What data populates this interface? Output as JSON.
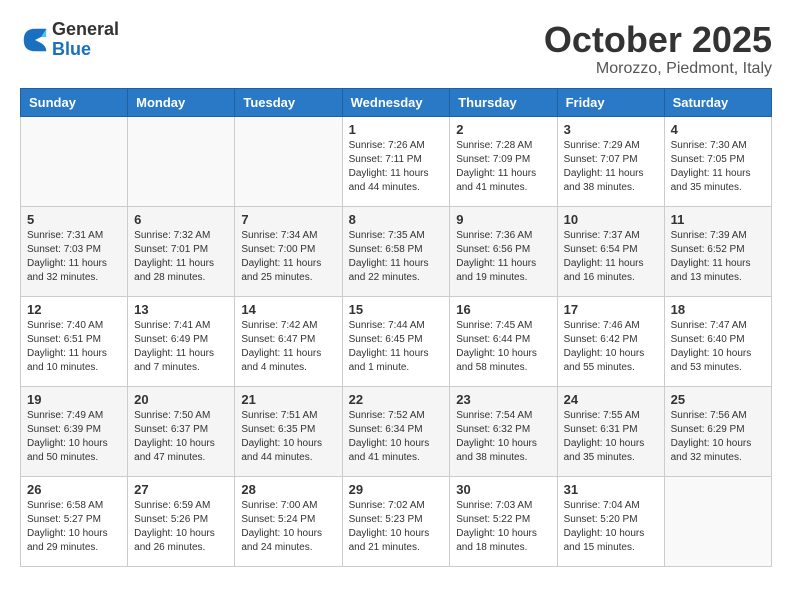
{
  "logo": {
    "line1": "General",
    "line2": "Blue"
  },
  "title": "October 2025",
  "location": "Morozzo, Piedmont, Italy",
  "weekdays": [
    "Sunday",
    "Monday",
    "Tuesday",
    "Wednesday",
    "Thursday",
    "Friday",
    "Saturday"
  ],
  "weeks": [
    [
      {
        "day": "",
        "info": ""
      },
      {
        "day": "",
        "info": ""
      },
      {
        "day": "",
        "info": ""
      },
      {
        "day": "1",
        "info": "Sunrise: 7:26 AM\nSunset: 7:11 PM\nDaylight: 11 hours and 44 minutes."
      },
      {
        "day": "2",
        "info": "Sunrise: 7:28 AM\nSunset: 7:09 PM\nDaylight: 11 hours and 41 minutes."
      },
      {
        "day": "3",
        "info": "Sunrise: 7:29 AM\nSunset: 7:07 PM\nDaylight: 11 hours and 38 minutes."
      },
      {
        "day": "4",
        "info": "Sunrise: 7:30 AM\nSunset: 7:05 PM\nDaylight: 11 hours and 35 minutes."
      }
    ],
    [
      {
        "day": "5",
        "info": "Sunrise: 7:31 AM\nSunset: 7:03 PM\nDaylight: 11 hours and 32 minutes."
      },
      {
        "day": "6",
        "info": "Sunrise: 7:32 AM\nSunset: 7:01 PM\nDaylight: 11 hours and 28 minutes."
      },
      {
        "day": "7",
        "info": "Sunrise: 7:34 AM\nSunset: 7:00 PM\nDaylight: 11 hours and 25 minutes."
      },
      {
        "day": "8",
        "info": "Sunrise: 7:35 AM\nSunset: 6:58 PM\nDaylight: 11 hours and 22 minutes."
      },
      {
        "day": "9",
        "info": "Sunrise: 7:36 AM\nSunset: 6:56 PM\nDaylight: 11 hours and 19 minutes."
      },
      {
        "day": "10",
        "info": "Sunrise: 7:37 AM\nSunset: 6:54 PM\nDaylight: 11 hours and 16 minutes."
      },
      {
        "day": "11",
        "info": "Sunrise: 7:39 AM\nSunset: 6:52 PM\nDaylight: 11 hours and 13 minutes."
      }
    ],
    [
      {
        "day": "12",
        "info": "Sunrise: 7:40 AM\nSunset: 6:51 PM\nDaylight: 11 hours and 10 minutes."
      },
      {
        "day": "13",
        "info": "Sunrise: 7:41 AM\nSunset: 6:49 PM\nDaylight: 11 hours and 7 minutes."
      },
      {
        "day": "14",
        "info": "Sunrise: 7:42 AM\nSunset: 6:47 PM\nDaylight: 11 hours and 4 minutes."
      },
      {
        "day": "15",
        "info": "Sunrise: 7:44 AM\nSunset: 6:45 PM\nDaylight: 11 hours and 1 minute."
      },
      {
        "day": "16",
        "info": "Sunrise: 7:45 AM\nSunset: 6:44 PM\nDaylight: 10 hours and 58 minutes."
      },
      {
        "day": "17",
        "info": "Sunrise: 7:46 AM\nSunset: 6:42 PM\nDaylight: 10 hours and 55 minutes."
      },
      {
        "day": "18",
        "info": "Sunrise: 7:47 AM\nSunset: 6:40 PM\nDaylight: 10 hours and 53 minutes."
      }
    ],
    [
      {
        "day": "19",
        "info": "Sunrise: 7:49 AM\nSunset: 6:39 PM\nDaylight: 10 hours and 50 minutes."
      },
      {
        "day": "20",
        "info": "Sunrise: 7:50 AM\nSunset: 6:37 PM\nDaylight: 10 hours and 47 minutes."
      },
      {
        "day": "21",
        "info": "Sunrise: 7:51 AM\nSunset: 6:35 PM\nDaylight: 10 hours and 44 minutes."
      },
      {
        "day": "22",
        "info": "Sunrise: 7:52 AM\nSunset: 6:34 PM\nDaylight: 10 hours and 41 minutes."
      },
      {
        "day": "23",
        "info": "Sunrise: 7:54 AM\nSunset: 6:32 PM\nDaylight: 10 hours and 38 minutes."
      },
      {
        "day": "24",
        "info": "Sunrise: 7:55 AM\nSunset: 6:31 PM\nDaylight: 10 hours and 35 minutes."
      },
      {
        "day": "25",
        "info": "Sunrise: 7:56 AM\nSunset: 6:29 PM\nDaylight: 10 hours and 32 minutes."
      }
    ],
    [
      {
        "day": "26",
        "info": "Sunrise: 6:58 AM\nSunset: 5:27 PM\nDaylight: 10 hours and 29 minutes."
      },
      {
        "day": "27",
        "info": "Sunrise: 6:59 AM\nSunset: 5:26 PM\nDaylight: 10 hours and 26 minutes."
      },
      {
        "day": "28",
        "info": "Sunrise: 7:00 AM\nSunset: 5:24 PM\nDaylight: 10 hours and 24 minutes."
      },
      {
        "day": "29",
        "info": "Sunrise: 7:02 AM\nSunset: 5:23 PM\nDaylight: 10 hours and 21 minutes."
      },
      {
        "day": "30",
        "info": "Sunrise: 7:03 AM\nSunset: 5:22 PM\nDaylight: 10 hours and 18 minutes."
      },
      {
        "day": "31",
        "info": "Sunrise: 7:04 AM\nSunset: 5:20 PM\nDaylight: 10 hours and 15 minutes."
      },
      {
        "day": "",
        "info": ""
      }
    ]
  ]
}
